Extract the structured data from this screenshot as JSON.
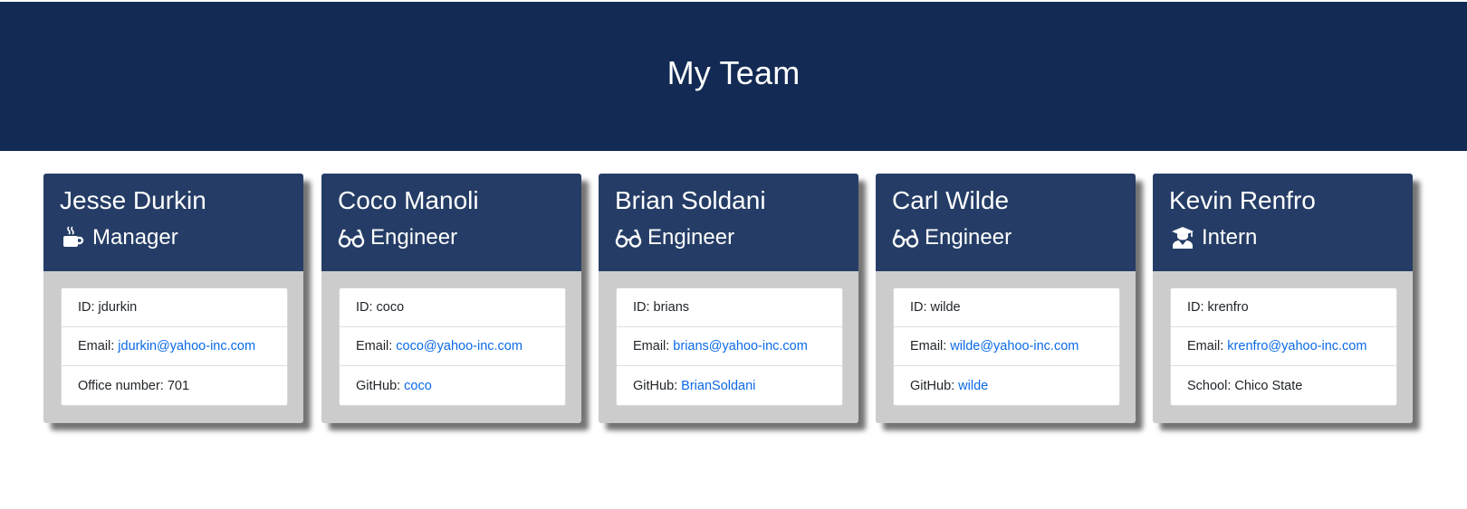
{
  "header": {
    "title": "My Team"
  },
  "employees": [
    {
      "name": "Jesse Durkin",
      "role": "Manager",
      "role_icon": "coffee-icon",
      "id_label": "ID:",
      "id": "jdurkin",
      "email_label": "Email:",
      "email": "jdurkin@yahoo-inc.com",
      "extra_label": "Office number:",
      "extra": "701"
    },
    {
      "name": "Coco Manoli",
      "role": "Engineer",
      "role_icon": "glasses-icon",
      "id_label": "ID:",
      "id": "coco",
      "email_label": "Email:",
      "email": "coco@yahoo-inc.com",
      "extra_label": "GitHub:",
      "extra": "coco"
    },
    {
      "name": "Brian Soldani",
      "role": "Engineer",
      "role_icon": "glasses-icon",
      "id_label": "ID:",
      "id": "brians",
      "email_label": "Email:",
      "email": "brians@yahoo-inc.com",
      "extra_label": "GitHub:",
      "extra": "BrianSoldani"
    },
    {
      "name": "Carl Wilde",
      "role": "Engineer",
      "role_icon": "glasses-icon",
      "id_label": "ID:",
      "id": "wilde",
      "email_label": "Email:",
      "email": "wilde@yahoo-inc.com",
      "extra_label": "GitHub:",
      "extra": "wilde"
    },
    {
      "name": "Kevin Renfro",
      "role": "Intern",
      "role_icon": "graduate-icon",
      "id_label": "ID:",
      "id": "krenfro",
      "email_label": "Email:",
      "email": "krenfro@yahoo-inc.com",
      "extra_label": "School:",
      "extra": "Chico State"
    }
  ],
  "colors": {
    "header_bg": "#132b54",
    "card_header_bg": "#253d66",
    "card_body_bg": "#cccccc",
    "link": "#0b6ae6"
  }
}
